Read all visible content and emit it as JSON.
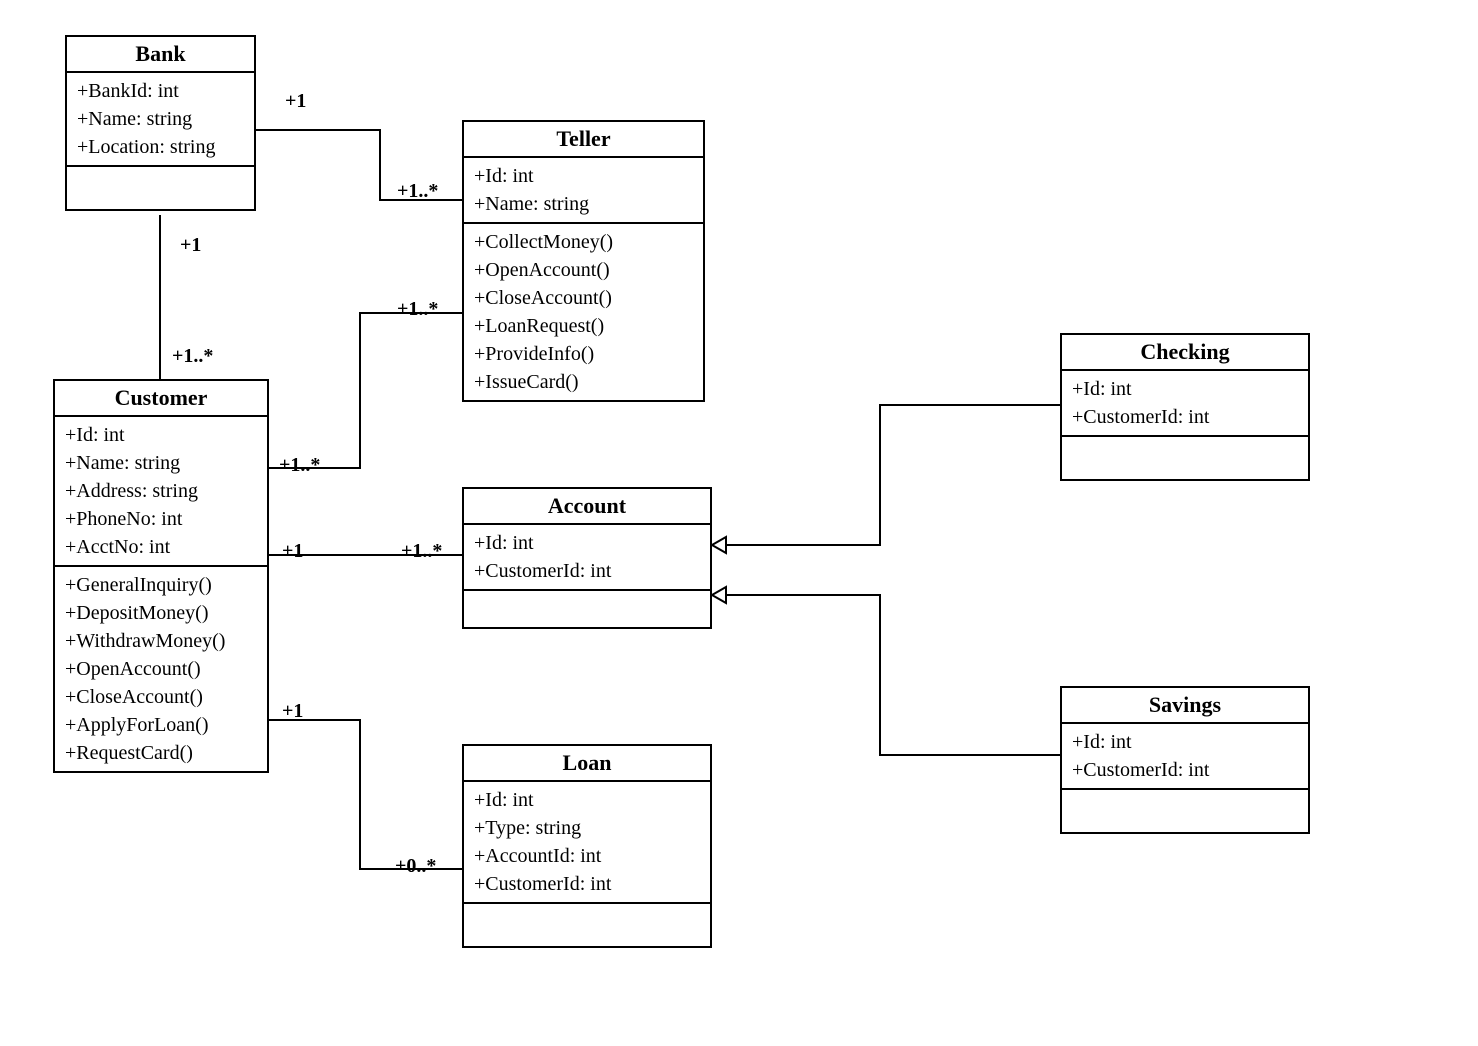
{
  "diagram_type": "UML class diagram",
  "classes": {
    "bank": {
      "name": "Bank",
      "attributes": [
        "+BankId: int",
        "+Name: string",
        "+Location: string"
      ],
      "methods": []
    },
    "teller": {
      "name": "Teller",
      "attributes": [
        "+Id: int",
        "+Name: string"
      ],
      "methods": [
        "+CollectMoney()",
        "+OpenAccount()",
        "+CloseAccount()",
        "+LoanRequest()",
        "+ProvideInfo()",
        "+IssueCard()"
      ]
    },
    "customer": {
      "name": "Customer",
      "attributes": [
        "+Id: int",
        "+Name: string",
        "+Address: string",
        "+PhoneNo: int",
        "+AcctNo: int"
      ],
      "methods": [
        "+GeneralInquiry()",
        "+DepositMoney()",
        "+WithdrawMoney()",
        "+OpenAccount()",
        "+CloseAccount()",
        "+ApplyForLoan()",
        "+RequestCard()"
      ]
    },
    "account": {
      "name": "Account",
      "attributes": [
        "+Id: int",
        "+CustomerId: int"
      ],
      "methods": []
    },
    "loan": {
      "name": "Loan",
      "attributes": [
        "+Id: int",
        "+Type: string",
        "+AccountId: int",
        "+CustomerId: int"
      ],
      "methods": []
    },
    "checking": {
      "name": "Checking",
      "attributes": [
        "+Id: int",
        "+CustomerId: int"
      ],
      "methods": []
    },
    "savings": {
      "name": "Savings",
      "attributes": [
        "+Id: int",
        "+CustomerId: int"
      ],
      "methods": []
    }
  },
  "relationships": [
    {
      "from": "Bank",
      "to": "Teller",
      "type": "association",
      "from_mult": "+1",
      "to_mult": "+1..*"
    },
    {
      "from": "Bank",
      "to": "Customer",
      "type": "association",
      "from_mult": "+1",
      "to_mult": "+1..*"
    },
    {
      "from": "Customer",
      "to": "Teller",
      "type": "association",
      "from_mult": "+1..*",
      "to_mult": "+1..*"
    },
    {
      "from": "Customer",
      "to": "Account",
      "type": "association",
      "from_mult": "+1",
      "to_mult": "+1..*"
    },
    {
      "from": "Customer",
      "to": "Loan",
      "type": "association",
      "from_mult": "+1",
      "to_mult": "+0..*"
    },
    {
      "from": "Checking",
      "to": "Account",
      "type": "generalization"
    },
    {
      "from": "Savings",
      "to": "Account",
      "type": "generalization"
    }
  ],
  "labels": {
    "bank_teller_from": "+1",
    "bank_teller_to": "+1..*",
    "bank_customer_from": "+1",
    "bank_customer_to": "+1..*",
    "customer_teller_from": "+1..*",
    "customer_teller_to": "+1..*",
    "customer_account_from": "+1",
    "customer_account_to": "+1..*",
    "customer_loan_from": "+1",
    "customer_loan_to": "+0..*"
  }
}
